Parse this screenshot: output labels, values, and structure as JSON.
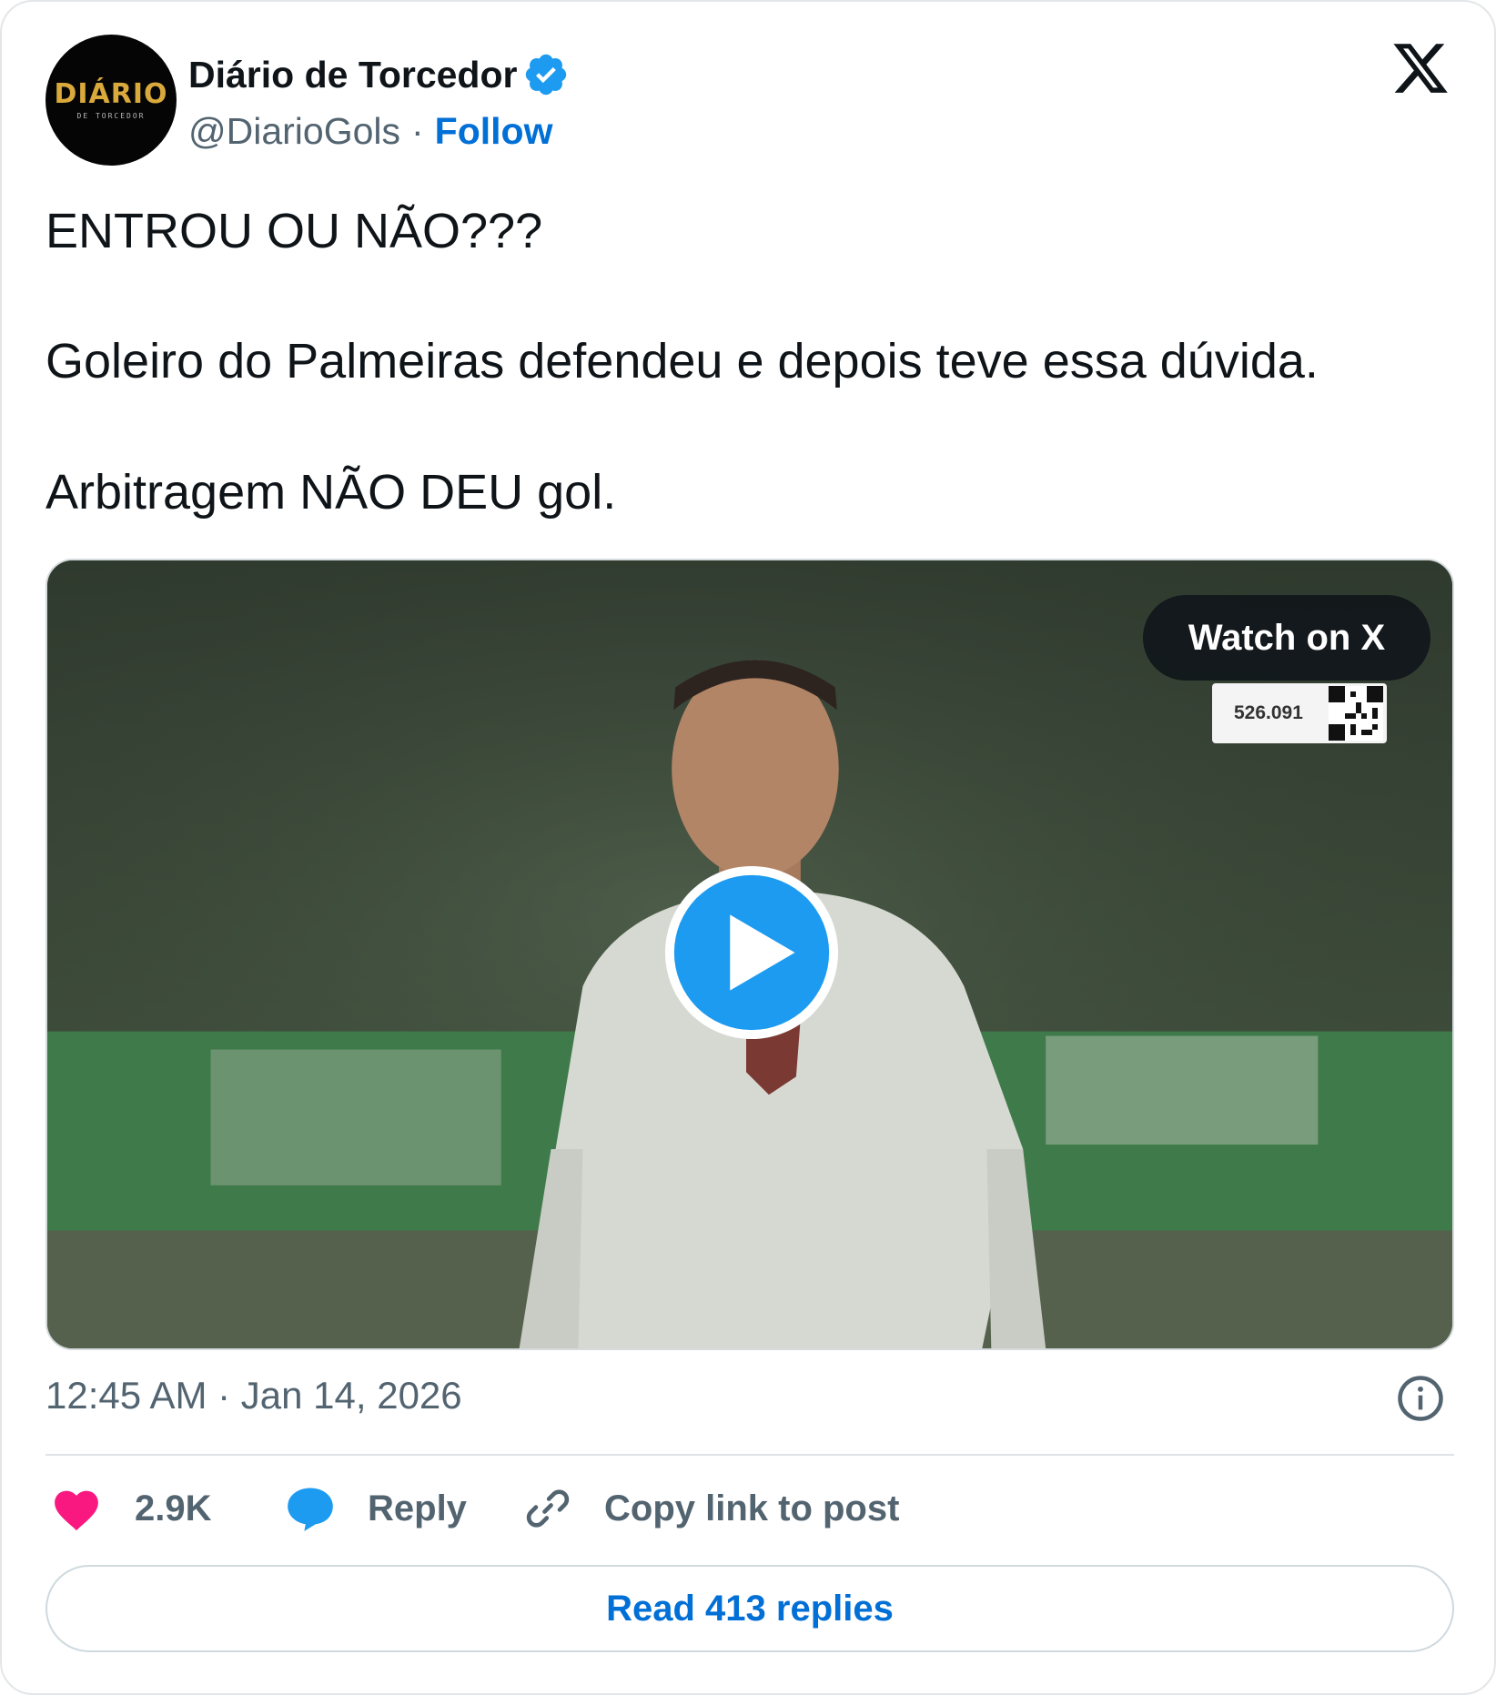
{
  "author": {
    "display_name": "Diário de Torcedor",
    "handle": "@DiarioGols",
    "separator": "·",
    "follow_label": "Follow",
    "avatar_logo_text": "DIÁRIO",
    "avatar_sub_text": "DE TORCEDOR",
    "verified": true
  },
  "post": {
    "lines": [
      "ENTROU OU NÃO???",
      "Goleiro do Palmeiras defendeu e depois teve essa dúvida.",
      "Arbitragem NÃO DEU gol."
    ],
    "timestamp": "12:45 AM · Jan 14, 2026"
  },
  "media": {
    "type": "video",
    "watch_label": "Watch on X",
    "overlay_number": "526.091"
  },
  "actions": {
    "like_count": "2.9K",
    "reply_label": "Reply",
    "copy_link_label": "Copy link to post"
  },
  "replies": {
    "read_label": "Read 413 replies"
  },
  "colors": {
    "accent_blue": "#006fd6",
    "verified_blue": "#1d9bf0",
    "like_pink": "#f91880",
    "muted_text": "#536471",
    "primary_text": "#0f1419"
  },
  "icons": {
    "verified": "verified-badge-icon",
    "platform": "x-logo-icon",
    "play": "play-icon",
    "info": "info-icon",
    "like": "heart-icon",
    "reply": "speech-bubble-icon",
    "copy": "link-icon"
  }
}
